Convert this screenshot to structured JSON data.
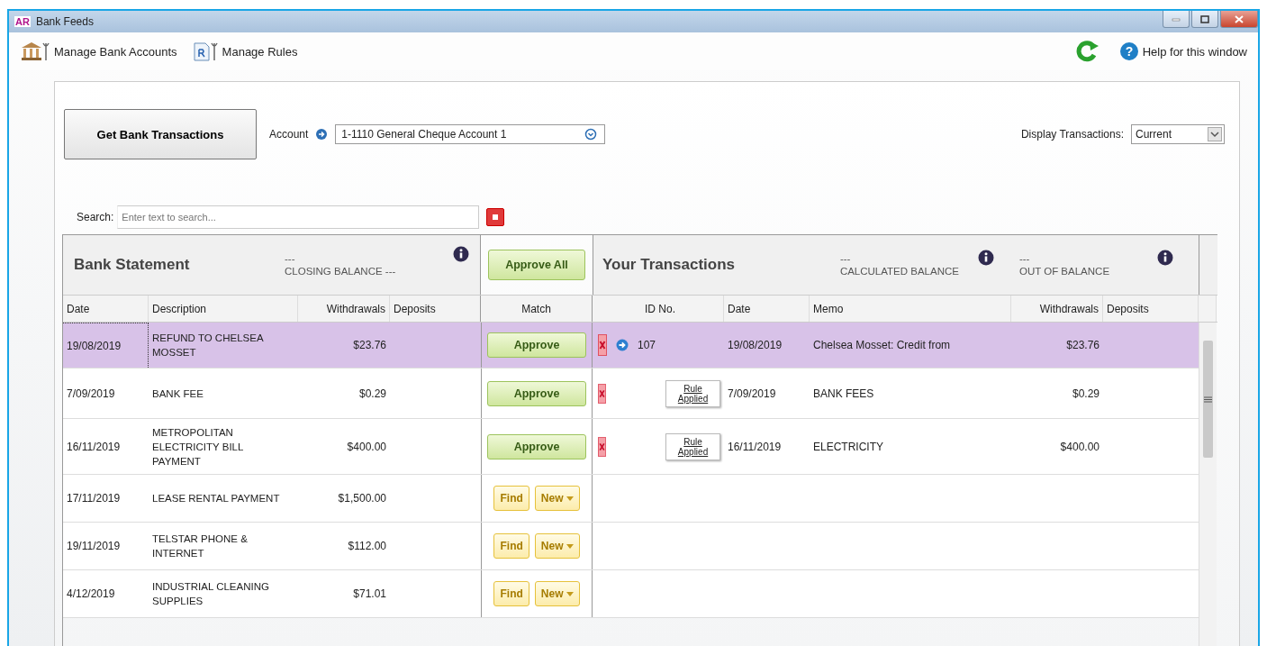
{
  "window": {
    "title": "Bank Feeds",
    "logo": "AR"
  },
  "toolbar": {
    "items": [
      {
        "label": "Manage Bank Accounts",
        "kind": "bank"
      },
      {
        "label": "Manage Rules",
        "kind": "rules"
      }
    ],
    "help": "Help for this window",
    "help_icon": "?"
  },
  "get_button": "Get Bank Transactions",
  "account": {
    "label": "Account",
    "value": "1-1110 General Cheque Account 1"
  },
  "display": {
    "label": "Display Transactions:",
    "value": "Current"
  },
  "search": {
    "label": "Search:",
    "placeholder": "Enter text to search..."
  },
  "bank_statement": {
    "title": "Bank Statement",
    "balance_value": "---",
    "balance_label": "CLOSING BALANCE ---",
    "columns": [
      "Date",
      "Description",
      "Withdrawals",
      "Deposits"
    ]
  },
  "match": {
    "approve_all": "Approve All",
    "column": "Match"
  },
  "your_transactions": {
    "title": "Your Transactions",
    "balances": [
      {
        "value": "---",
        "label": "CALCULATED BALANCE"
      },
      {
        "value": "---",
        "label": "OUT OF BALANCE"
      }
    ],
    "columns": [
      "ID No.",
      "Date",
      "Memo",
      "Withdrawals",
      "Deposits"
    ]
  },
  "rows": [
    {
      "date": "19/08/2019",
      "description": "REFUND TO CHELSEA MOSSET",
      "withdrawal": "$23.76",
      "selected": true,
      "match": {
        "kind": "approve",
        "label": "Approve"
      },
      "transaction": {
        "kind": "link",
        "id": "107",
        "date": "19/08/2019",
        "memo": "Chelsea Mosset: Credit from",
        "withdrawal": "$23.76"
      }
    },
    {
      "date": "7/09/2019",
      "description": "BANK FEE",
      "withdrawal": "$0.29",
      "selected": false,
      "match": {
        "kind": "approve",
        "label": "Approve"
      },
      "transaction": {
        "kind": "rule",
        "rule": "Rule Applied",
        "date": "7/09/2019",
        "memo": "BANK FEES",
        "withdrawal": "$0.29"
      }
    },
    {
      "date": "16/11/2019",
      "description": "METROPOLITAN ELECTRICITY BILL PAYMENT",
      "withdrawal": "$400.00",
      "selected": false,
      "match": {
        "kind": "approve",
        "label": "Approve"
      },
      "transaction": {
        "kind": "rule",
        "rule": "Rule Applied",
        "date": "16/11/2019",
        "memo": "ELECTRICITY",
        "withdrawal": "$400.00"
      }
    },
    {
      "date": "17/11/2019",
      "description": "LEASE RENTAL PAYMENT",
      "withdrawal": "$1,500.00",
      "selected": false,
      "match": {
        "kind": "find_new",
        "find": "Find",
        "new": "New"
      }
    },
    {
      "date": "19/11/2019",
      "description": "TELSTAR PHONE & INTERNET",
      "withdrawal": "$112.00",
      "selected": false,
      "match": {
        "kind": "find_new",
        "find": "Find",
        "new": "New"
      }
    },
    {
      "date": "4/12/2019",
      "description": "INDUSTRIAL CLEANING SUPPLIES",
      "withdrawal": "$71.01",
      "selected": false,
      "match": {
        "kind": "find_new",
        "find": "Find",
        "new": "New"
      }
    }
  ]
}
